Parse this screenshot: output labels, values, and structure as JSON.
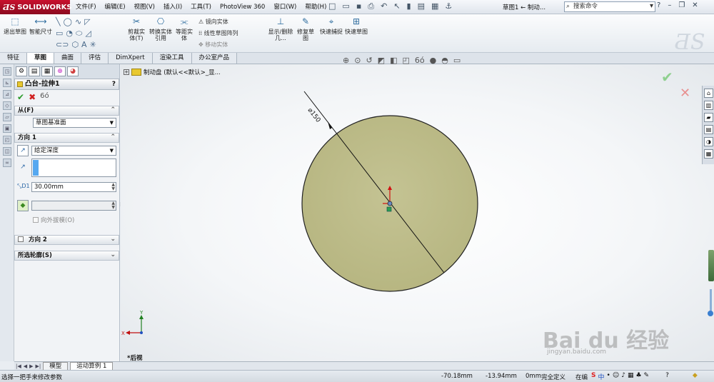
{
  "app": {
    "brand": "SOLIDWORKS",
    "document_title": "草图1 ← 制动...",
    "search_placeholder": "搜索命令"
  },
  "menu": [
    "文件(F)",
    "编辑(E)",
    "视图(V)",
    "插入(I)",
    "工具(T)",
    "PhotoView 360",
    "窗口(W)",
    "帮助(H)"
  ],
  "command_manager": {
    "exit_sketch": "退出草图",
    "smart_dimension": "智能尺寸",
    "trim_entities": "剪裁实体(T)",
    "convert_entities": "转换实体引用",
    "offset_entities": "等距实体",
    "mirror_entities": "镜向实体",
    "linear_pattern": "线性草图阵列",
    "move_entities": "移动实体",
    "display_delete_relations": "显示/删除几...",
    "repair_sketch": "修复草图",
    "quick_snaps": "快速捕捉",
    "rapid_sketch": "快速草图"
  },
  "tabs": [
    {
      "label": "特征",
      "active": false
    },
    {
      "label": "草图",
      "active": true
    },
    {
      "label": "曲面",
      "active": false
    },
    {
      "label": "评估",
      "active": false
    },
    {
      "label": "DimXpert",
      "active": false
    },
    {
      "label": "渲染工具",
      "active": false
    },
    {
      "label": "办公室产品",
      "active": false
    }
  ],
  "property_manager": {
    "title": "凸台-拉伸1",
    "help": "?",
    "from_section": {
      "label": "从(F)",
      "value": "草图基准面"
    },
    "direction1": {
      "label": "方向 1",
      "end_condition": "给定深度",
      "depth": "30.00mm",
      "draft_outward_label": "向外拔模(O)"
    },
    "direction2": {
      "label": "方向 2"
    },
    "selected_contours": {
      "label": "所选轮廓(S)"
    }
  },
  "feature_tree": {
    "root_label": "制动盘 (默认<<默认>_显..."
  },
  "drawing": {
    "diameter_label": "⌀150",
    "view_name": "*后视",
    "axis_x": "X",
    "axis_y": "Y",
    "circle_fill": "#bdbc88",
    "dimension_color": "#000000"
  },
  "watermark": {
    "text": "Bai du 经验",
    "url": "jingyan.baidu.com"
  },
  "bottom_tabs": [
    {
      "label": "模型",
      "active": false
    },
    {
      "label": "运动算例 1",
      "active": true
    }
  ],
  "status": {
    "message": "选择一把手来修改参数",
    "x_coord": "-70.18mm",
    "y_coord": "-13.94mm",
    "z_coord": "0mm",
    "sketch_state": "完全定义",
    "editing": "在编"
  }
}
